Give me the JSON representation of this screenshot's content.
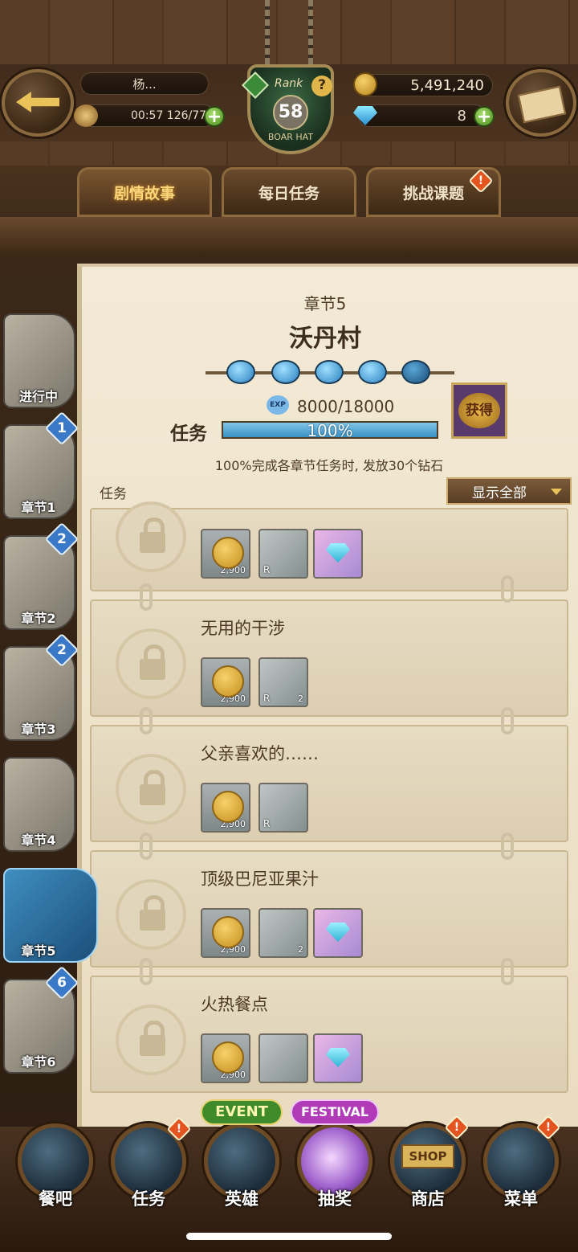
{
  "header": {
    "player_name": "杨...",
    "stamina": "00:57 126/77",
    "rank_label": "Rank",
    "rank": "58",
    "guild": "BOAR HAT",
    "gold": "5,491,240",
    "diamonds": "8"
  },
  "tabs": [
    {
      "label": "剧情故事",
      "active": true
    },
    {
      "label": "每日任务",
      "active": false
    },
    {
      "label": "挑战课题",
      "active": false,
      "alert": "!"
    }
  ],
  "chapter": {
    "number": "章节5",
    "name": "沃丹村",
    "exp": "8000/18000",
    "exp_icon": "EXP",
    "quest_label": "任务",
    "progress": "100%",
    "progress_value": 1.0,
    "claim_button": "获得",
    "reward_note": "100%完成各章节任务时, 发放30个钻石",
    "list_label": "任务",
    "filter": "显示全部"
  },
  "sidebar": [
    {
      "label": "进行中",
      "badge": ""
    },
    {
      "label": "章节1",
      "badge": "1"
    },
    {
      "label": "章节2",
      "badge": "2"
    },
    {
      "label": "章节3",
      "badge": "2"
    },
    {
      "label": "章节4",
      "badge": ""
    },
    {
      "label": "章节5",
      "badge": "",
      "active": true
    },
    {
      "label": "章节6",
      "badge": "6"
    }
  ],
  "missions": [
    {
      "title": "",
      "rewards": [
        {
          "type": "coin",
          "qty": "2,900"
        },
        {
          "type": "item",
          "rarity": "R"
        },
        {
          "type": "diamond"
        }
      ]
    },
    {
      "title": "无用的干涉",
      "rewards": [
        {
          "type": "coin",
          "qty": "2,900"
        },
        {
          "type": "item",
          "rarity": "R",
          "qty": "2"
        }
      ]
    },
    {
      "title": "父亲喜欢的……",
      "rewards": [
        {
          "type": "coin",
          "qty": "2,900"
        },
        {
          "type": "item",
          "rarity": "R"
        }
      ]
    },
    {
      "title": "顶级巴尼亚果汁",
      "rewards": [
        {
          "type": "coin",
          "qty": "2,900"
        },
        {
          "type": "item",
          "qty": "2"
        },
        {
          "type": "diamond"
        }
      ]
    },
    {
      "title": "火热餐点",
      "rewards": [
        {
          "type": "coin",
          "qty": "2,900"
        },
        {
          "type": "item"
        },
        {
          "type": "diamond"
        }
      ]
    }
  ],
  "nav": [
    {
      "label": "餐吧",
      "banner": ""
    },
    {
      "label": "任务",
      "banner": "",
      "alert": "!"
    },
    {
      "label": "英雄",
      "banner": "EVENT"
    },
    {
      "label": "抽奖",
      "banner": "FESTIVAL"
    },
    {
      "label": "商店",
      "banner": "SHOP",
      "alert": "!"
    },
    {
      "label": "菜单",
      "banner": "",
      "alert": "!"
    }
  ]
}
